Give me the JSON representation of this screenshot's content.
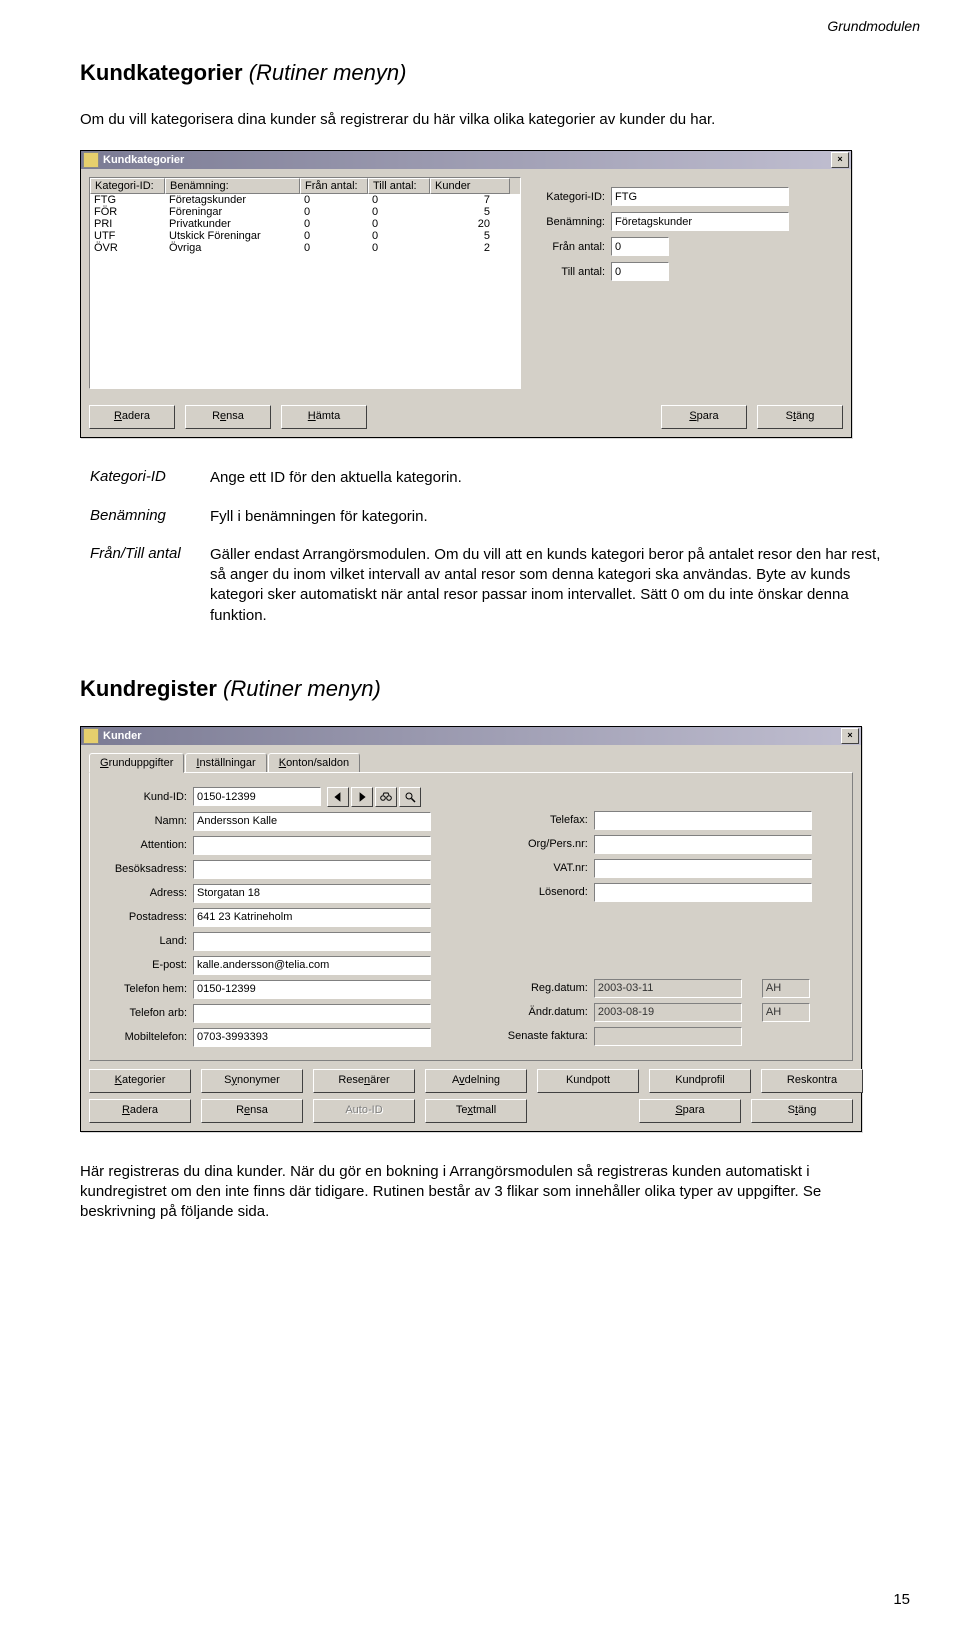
{
  "header": {
    "module": "Grundmodulen"
  },
  "section1": {
    "title": "Kundkategorier",
    "paren": "(Rutiner menyn)",
    "intro": "Om du vill kategorisera dina kunder så registrerar du här vilka olika kategorier av kunder du har."
  },
  "kk_window": {
    "title": "Kundkategorier",
    "columns": {
      "id": "Kategori-ID:",
      "ben": "Benämning:",
      "fran": "Från antal:",
      "till": "Till antal:",
      "kunder": "Kunder"
    },
    "rows": [
      {
        "id": "FTG",
        "ben": "Företagskunder",
        "fa": "0",
        "ta": "0",
        "ku": "7"
      },
      {
        "id": "FÖR",
        "ben": "Föreningar",
        "fa": "0",
        "ta": "0",
        "ku": "5"
      },
      {
        "id": "PRI",
        "ben": "Privatkunder",
        "fa": "0",
        "ta": "0",
        "ku": "20"
      },
      {
        "id": "UTF",
        "ben": "Utskick Föreningar",
        "fa": "0",
        "ta": "0",
        "ku": "5"
      },
      {
        "id": "ÖVR",
        "ben": "Övriga",
        "fa": "0",
        "ta": "0",
        "ku": "2"
      }
    ],
    "form": {
      "kategori_label": "Kategori-ID:",
      "kategori_value": "FTG",
      "ben_label": "Benämning:",
      "ben_value": "Företagskunder",
      "fran_label": "Från antal:",
      "fran_value": "0",
      "till_label": "Till antal:",
      "till_value": "0"
    },
    "buttons": {
      "radera": "Radera",
      "rensa": "Rensa",
      "hamta": "Hämta",
      "spara": "Spara",
      "stang": "Stäng"
    }
  },
  "defs": {
    "kategori_id": {
      "term": "Kategori-ID",
      "desc": "Ange ett ID för den aktuella kategorin."
    },
    "benamning": {
      "term": "Benämning",
      "desc": "Fyll i benämningen för kategorin."
    },
    "fran_till": {
      "term": "Från/Till antal",
      "desc": "Gäller endast Arrangörsmodulen. Om du vill att en kunds kategori beror på antalet resor den har rest, så anger du inom vilket intervall av antal resor som denna kategori ska användas. Byte av kunds kategori sker automatiskt när antal resor passar inom intervallet. Sätt 0 om du inte önskar denna funktion."
    }
  },
  "section2": {
    "title": "Kundregister",
    "paren": "(Rutiner menyn)"
  },
  "ku_window": {
    "title": "Kunder",
    "tabs": {
      "t1": "Grunduppgifter",
      "t2": "Inställningar",
      "t3": "Konton/saldon"
    },
    "labels": {
      "kundid": "Kund-ID:",
      "namn": "Namn:",
      "attention": "Attention:",
      "besok": "Besöksadress:",
      "adress": "Adress:",
      "post": "Postadress:",
      "land": "Land:",
      "epost": "E-post:",
      "telhem": "Telefon hem:",
      "telarb": "Telefon arb:",
      "mobil": "Mobiltelefon:",
      "telefax": "Telefax:",
      "orgpers": "Org/Pers.nr:",
      "vat": "VAT.nr:",
      "losen": "Lösenord:",
      "regdat": "Reg.datum:",
      "andrdat": "Ändr.datum:",
      "senfakt": "Senaste faktura:"
    },
    "values": {
      "kundid": "0150-12399",
      "namn": "Andersson Kalle",
      "attention": "",
      "besok": "",
      "adress": "Storgatan 18",
      "post": "641 23 Katrineholm",
      "land": "",
      "epost": "kalle.andersson@telia.com",
      "telhem": "0150-12399",
      "telarb": "",
      "mobil": "0703-3993393",
      "telefax": "",
      "orgpers": "",
      "vat": "",
      "losen": "",
      "regdat": "2003-03-11",
      "regby": "AH",
      "andrdat": "2003-08-19",
      "andrby": "AH",
      "senfakt": ""
    },
    "buttons": {
      "kategorier": "Kategorier",
      "synonymer": "Synonymer",
      "resenarer": "Resenärer",
      "avdelning": "Avdelning",
      "kundpott": "Kundpott",
      "kundprofil": "Kundprofil",
      "reskontra": "Reskontra",
      "radera": "Radera",
      "rensa": "Rensa",
      "autoid": "Auto-ID",
      "textmall": "Textmall",
      "spara": "Spara",
      "stang": "Stäng"
    }
  },
  "outro": "Här registreras du dina kunder. När du gör en bokning i Arrangörsmodulen så registreras kunden automatiskt i kundregistret om den inte finns där tidigare. Rutinen består av 3 flikar som innehåller olika typer av uppgifter. Se beskrivning på följande sida.",
  "page_number": "15"
}
